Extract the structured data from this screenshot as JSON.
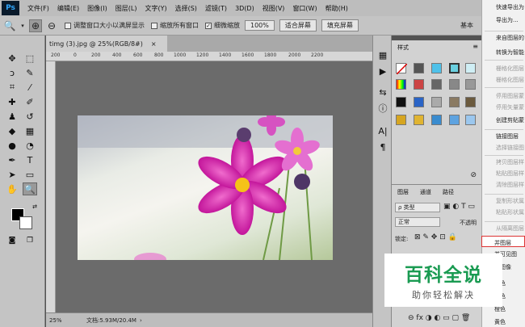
{
  "app": {
    "logo": "Ps"
  },
  "menu": [
    "文件(F)",
    "编辑(E)",
    "图像(I)",
    "图层(L)",
    "文字(Y)",
    "选择(S)",
    "滤镜(T)",
    "3D(D)",
    "视图(V)",
    "窗口(W)",
    "帮助(H)"
  ],
  "options": {
    "resize_windows": "调整窗口大小以满屏显示",
    "zoom_all": "缩放所有窗口",
    "scrubby_zoom": "细微缩放",
    "zoom_value": "100%",
    "fit_screen": "适合屏幕",
    "fill_screen": "填充屏幕",
    "workspace": "基本"
  },
  "document": {
    "tab_title": "timg (3).jpg @ 25%(RGB/8#)",
    "close": "×"
  },
  "ruler": [
    "200",
    "0",
    "200",
    "400",
    "600",
    "800",
    "1000",
    "1200",
    "1400",
    "1600",
    "1800",
    "2000",
    "2200"
  ],
  "status": {
    "zoom": "25%",
    "doc": "文档:5.93M/20.4M"
  },
  "styles_panel": {
    "tab": "样式"
  },
  "layers_panel": {
    "tabs": [
      "图层",
      "通道",
      "路径"
    ],
    "kind": "ρ 类型",
    "blend": "正常",
    "opacity_label": "不透明",
    "lock_label": "锁定:"
  },
  "context_menu": {
    "items": [
      {
        "label": "快速导出为",
        "dim": false
      },
      {
        "label": "导出为...",
        "dim": false
      },
      {
        "label": "来自图层的",
        "dim": false
      },
      {
        "label": "转换为智能",
        "dim": false
      },
      {
        "label": "栅格化图层",
        "dim": true
      },
      {
        "label": "栅格化图层",
        "dim": true
      },
      {
        "label": "停用图层蒙",
        "dim": true
      },
      {
        "label": "停用矢量蒙",
        "dim": true
      },
      {
        "label": "创建剪贴蒙",
        "dim": false
      },
      {
        "label": "链接图层",
        "dim": false
      },
      {
        "label": "选择链接图",
        "dim": true
      },
      {
        "label": "拷贝图层样",
        "dim": true
      },
      {
        "label": "粘贴图层样",
        "dim": true
      },
      {
        "label": "清除图层样",
        "dim": true
      },
      {
        "label": "复制形状属",
        "dim": true
      },
      {
        "label": "粘贴形状属",
        "dim": true
      },
      {
        "label": "从隔离图层",
        "dim": true
      },
      {
        "label": "并图层",
        "dim": false
      },
      {
        "label": "并可见图",
        "dim": false
      },
      {
        "label": "合图像",
        "dim": false
      },
      {
        "label": "颜色",
        "dim": false
      },
      {
        "label": "红色",
        "dim": false
      },
      {
        "label": "橙色",
        "dim": false
      },
      {
        "label": "黄色",
        "dim": false
      }
    ]
  },
  "watermark": {
    "main": "百科全说",
    "sub": "助你轻松解决"
  }
}
